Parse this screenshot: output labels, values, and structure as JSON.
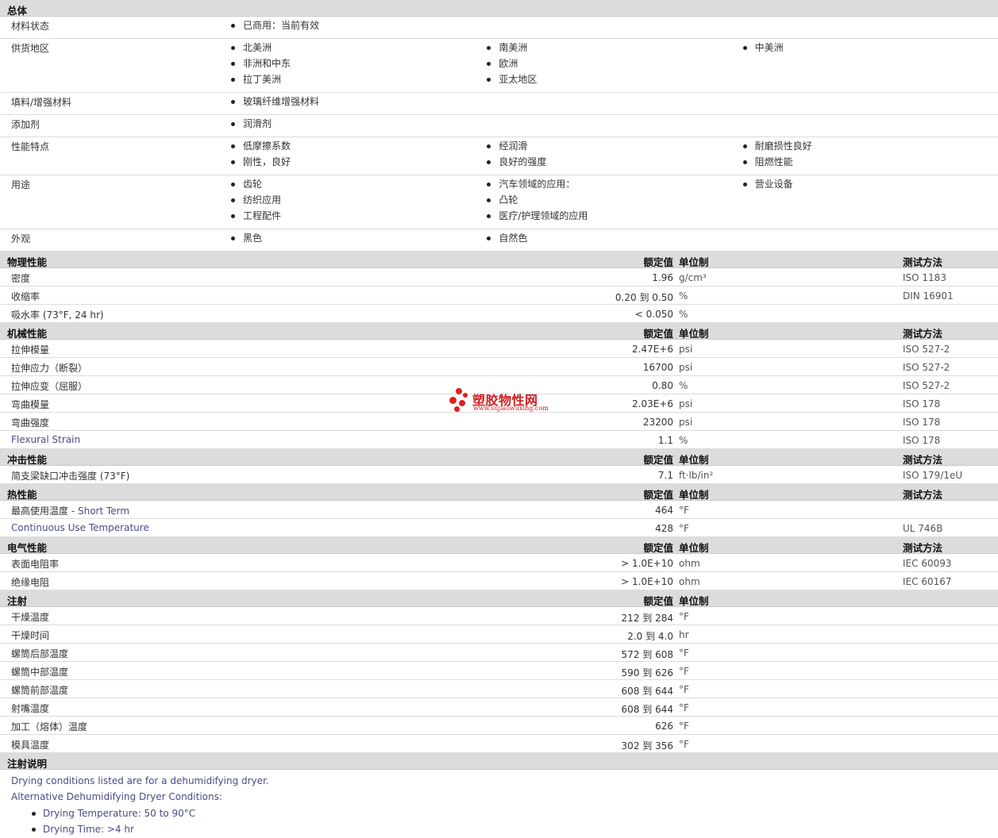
{
  "general": {
    "title": "总体",
    "rows": [
      {
        "label": "材料状态",
        "cols": [
          [
            "已商用：当前有效"
          ],
          [],
          []
        ]
      },
      {
        "label": "供货地区",
        "cols": [
          [
            "北美洲",
            "非洲和中东",
            "拉丁美洲"
          ],
          [
            "南美洲",
            "欧洲",
            "亚太地区"
          ],
          [
            "中美洲"
          ]
        ]
      },
      {
        "label": "填料/增强材料",
        "cols": [
          [
            "玻璃纤维增强材料"
          ],
          [],
          []
        ]
      },
      {
        "label": "添加剂",
        "cols": [
          [
            "润滑剂"
          ],
          [],
          []
        ]
      },
      {
        "label": "性能特点",
        "cols": [
          [
            "低摩擦系数",
            "刚性，良好"
          ],
          [
            "经润滑",
            "良好的强度"
          ],
          [
            "耐磨损性良好",
            "阻燃性能"
          ]
        ]
      },
      {
        "label": "用途",
        "cols": [
          [
            "齿轮",
            "纺织应用",
            "工程配件"
          ],
          [
            "汽车领域的应用：",
            "凸轮",
            "医疗/护理领域的应用"
          ],
          [
            "营业设备"
          ]
        ]
      },
      {
        "label": "外观",
        "cols": [
          [
            "黑色"
          ],
          [
            "自然色"
          ],
          []
        ]
      }
    ]
  },
  "headers": {
    "nominal": "额定值",
    "unit": "单位制",
    "method": "测试方法"
  },
  "sections": [
    {
      "title": "物理性能",
      "show_method": true,
      "rows": [
        {
          "label": "密度",
          "value": "1.96",
          "unit": "g/cm³",
          "method": "ISO 1183"
        },
        {
          "label": "收缩率",
          "value": "0.20 到  0.50",
          "unit": "%",
          "method": "DIN 16901"
        },
        {
          "label": "吸水率 (73°F, 24 hr)",
          "value": "< 0.050",
          "unit": "%",
          "method": ""
        }
      ]
    },
    {
      "title": "机械性能",
      "show_method": true,
      "rows": [
        {
          "label": "拉伸模量",
          "value": "2.47E+6",
          "unit": "psi",
          "method": "ISO 527-2"
        },
        {
          "label": "拉伸应力（断裂）",
          "value": "16700",
          "unit": "psi",
          "method": "ISO 527-2"
        },
        {
          "label": "拉伸应变（屈服）",
          "value": "0.80",
          "unit": "%",
          "method": "ISO 527-2"
        },
        {
          "label": "弯曲模量",
          "value": "2.03E+6",
          "unit": "psi",
          "method": "ISO 178"
        },
        {
          "label": "弯曲强度",
          "value": "23200",
          "unit": "psi",
          "method": "ISO 178"
        },
        {
          "label": "Flexural Strain",
          "en": true,
          "value": "1.1",
          "unit": "%",
          "method": "ISO 178"
        }
      ]
    },
    {
      "title": "冲击性能",
      "show_method": true,
      "rows": [
        {
          "label": "简支梁缺口冲击强度 (73°F)",
          "value": "7.1",
          "unit": "ft·lb/in²",
          "method": "ISO 179/1eU"
        }
      ]
    },
    {
      "title": "热性能",
      "show_method": true,
      "rows": [
        {
          "label": "最高使用温度",
          "sub": " - Short Term",
          "value": "464",
          "unit": "°F",
          "method": ""
        },
        {
          "label": "Continuous Use Temperature",
          "en": true,
          "value": "428",
          "unit": "°F",
          "method": "UL 746B"
        }
      ]
    },
    {
      "title": "电气性能",
      "show_method": true,
      "rows": [
        {
          "label": "表面电阻率",
          "value": "> 1.0E+10",
          "unit": "ohm",
          "method": "IEC 60093"
        },
        {
          "label": "绝缘电阻",
          "value": "> 1.0E+10",
          "unit": "ohm",
          "method": "IEC 60167"
        }
      ]
    },
    {
      "title": "注射",
      "show_method": false,
      "rows": [
        {
          "label": "干燥温度",
          "value": "212 到  284",
          "unit": "°F",
          "method": ""
        },
        {
          "label": "干燥时间",
          "value": "2.0 到  4.0",
          "unit": "hr",
          "method": ""
        },
        {
          "label": "螺筒后部温度",
          "value": "572 到  608",
          "unit": "°F",
          "method": ""
        },
        {
          "label": "螺筒中部温度",
          "value": "590 到  626",
          "unit": "°F",
          "method": ""
        },
        {
          "label": "螺筒前部温度",
          "value": "608 到  644",
          "unit": "°F",
          "method": ""
        },
        {
          "label": "射嘴温度",
          "value": "608 到  644",
          "unit": "°F",
          "method": ""
        },
        {
          "label": "加工（熔体）温度",
          "value": "626",
          "unit": "°F",
          "method": ""
        },
        {
          "label": "模具温度",
          "value": "302 到  356",
          "unit": "°F",
          "method": ""
        }
      ]
    }
  ],
  "notes": {
    "title": "注射说明",
    "lines": [
      "Drying conditions listed are for a dehumidifying dryer.",
      "Alternative Dehumidifying Dryer Conditions:"
    ],
    "bullets": [
      "Drying Temperature: 50 to 90°C",
      "Drying Time: >4 hr"
    ]
  },
  "watermark": {
    "text": "塑胶物性网",
    "url": "www.sujiaowuxing.com",
    "color": "#e02020"
  }
}
